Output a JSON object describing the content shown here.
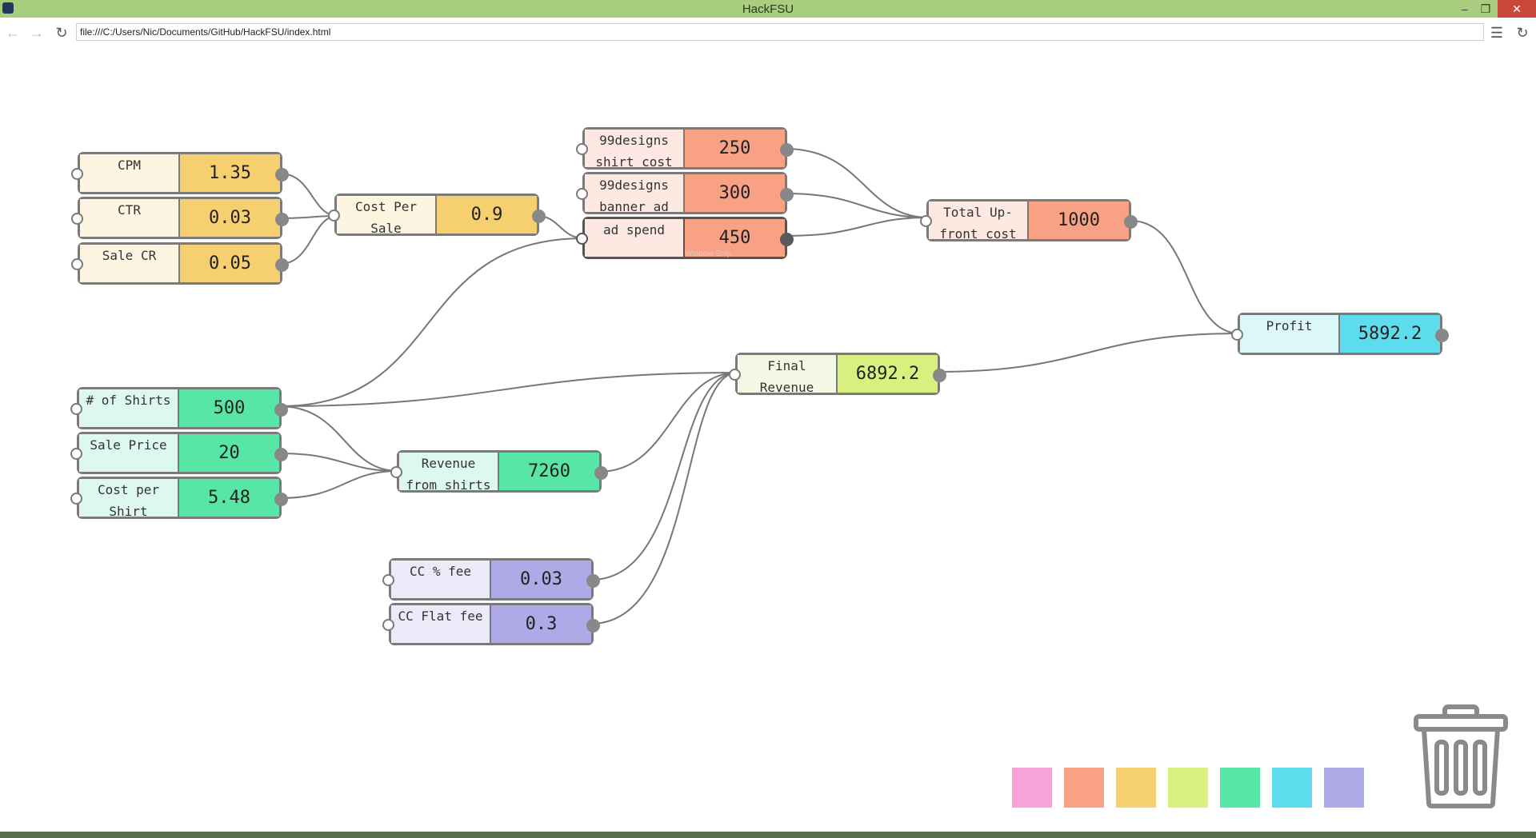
{
  "window": {
    "title": "HackFSU"
  },
  "nav": {
    "url": "file:///C:/Users/Nic/Documents/GitHub/HackFSU/index.html"
  },
  "watermark": "Window Snip",
  "nodes": {
    "cpm": {
      "label": "CPM",
      "value": "1.35"
    },
    "ctr": {
      "label": "CTR",
      "value": "0.03"
    },
    "sale_cr": {
      "label": "Sale CR",
      "value": "0.05"
    },
    "cost_per_sale": {
      "label": "Cost Per Sale",
      "value": "0.9"
    },
    "shirt_cost": {
      "label": "99designs shirt cost",
      "value": "250"
    },
    "banner_ad": {
      "label": "99designs banner ad",
      "value": "300"
    },
    "ad_spend": {
      "label": "ad spend",
      "value": "450"
    },
    "upfront": {
      "label": "Total Up-front cost",
      "value": "1000"
    },
    "profit": {
      "label": "Profit",
      "value": "5892.2"
    },
    "final_revenue": {
      "label": "Final Revenue",
      "value": "6892.2"
    },
    "num_shirts": {
      "label": "# of Shirts",
      "value": "500"
    },
    "sale_price": {
      "label": "Sale Price",
      "value": "20"
    },
    "cost_per_shirt": {
      "label": "Cost per Shirt",
      "value": "5.48"
    },
    "revenue_shirts": {
      "label": "Revenue from shirts",
      "value": "7260"
    },
    "cc_pct_fee": {
      "label": "CC % fee",
      "value": "0.03"
    },
    "cc_flat_fee": {
      "label": "CC Flat fee",
      "value": "0.3"
    }
  },
  "palette": [
    "#f7a3d8",
    "#f8a185",
    "#f6d06f",
    "#d9f07f",
    "#58e6a6",
    "#5ddcee",
    "#aeaae8"
  ],
  "colors": {
    "wire": "#777777",
    "titlebar": "#a9cd7f",
    "node_border": "#7a7a7a"
  }
}
